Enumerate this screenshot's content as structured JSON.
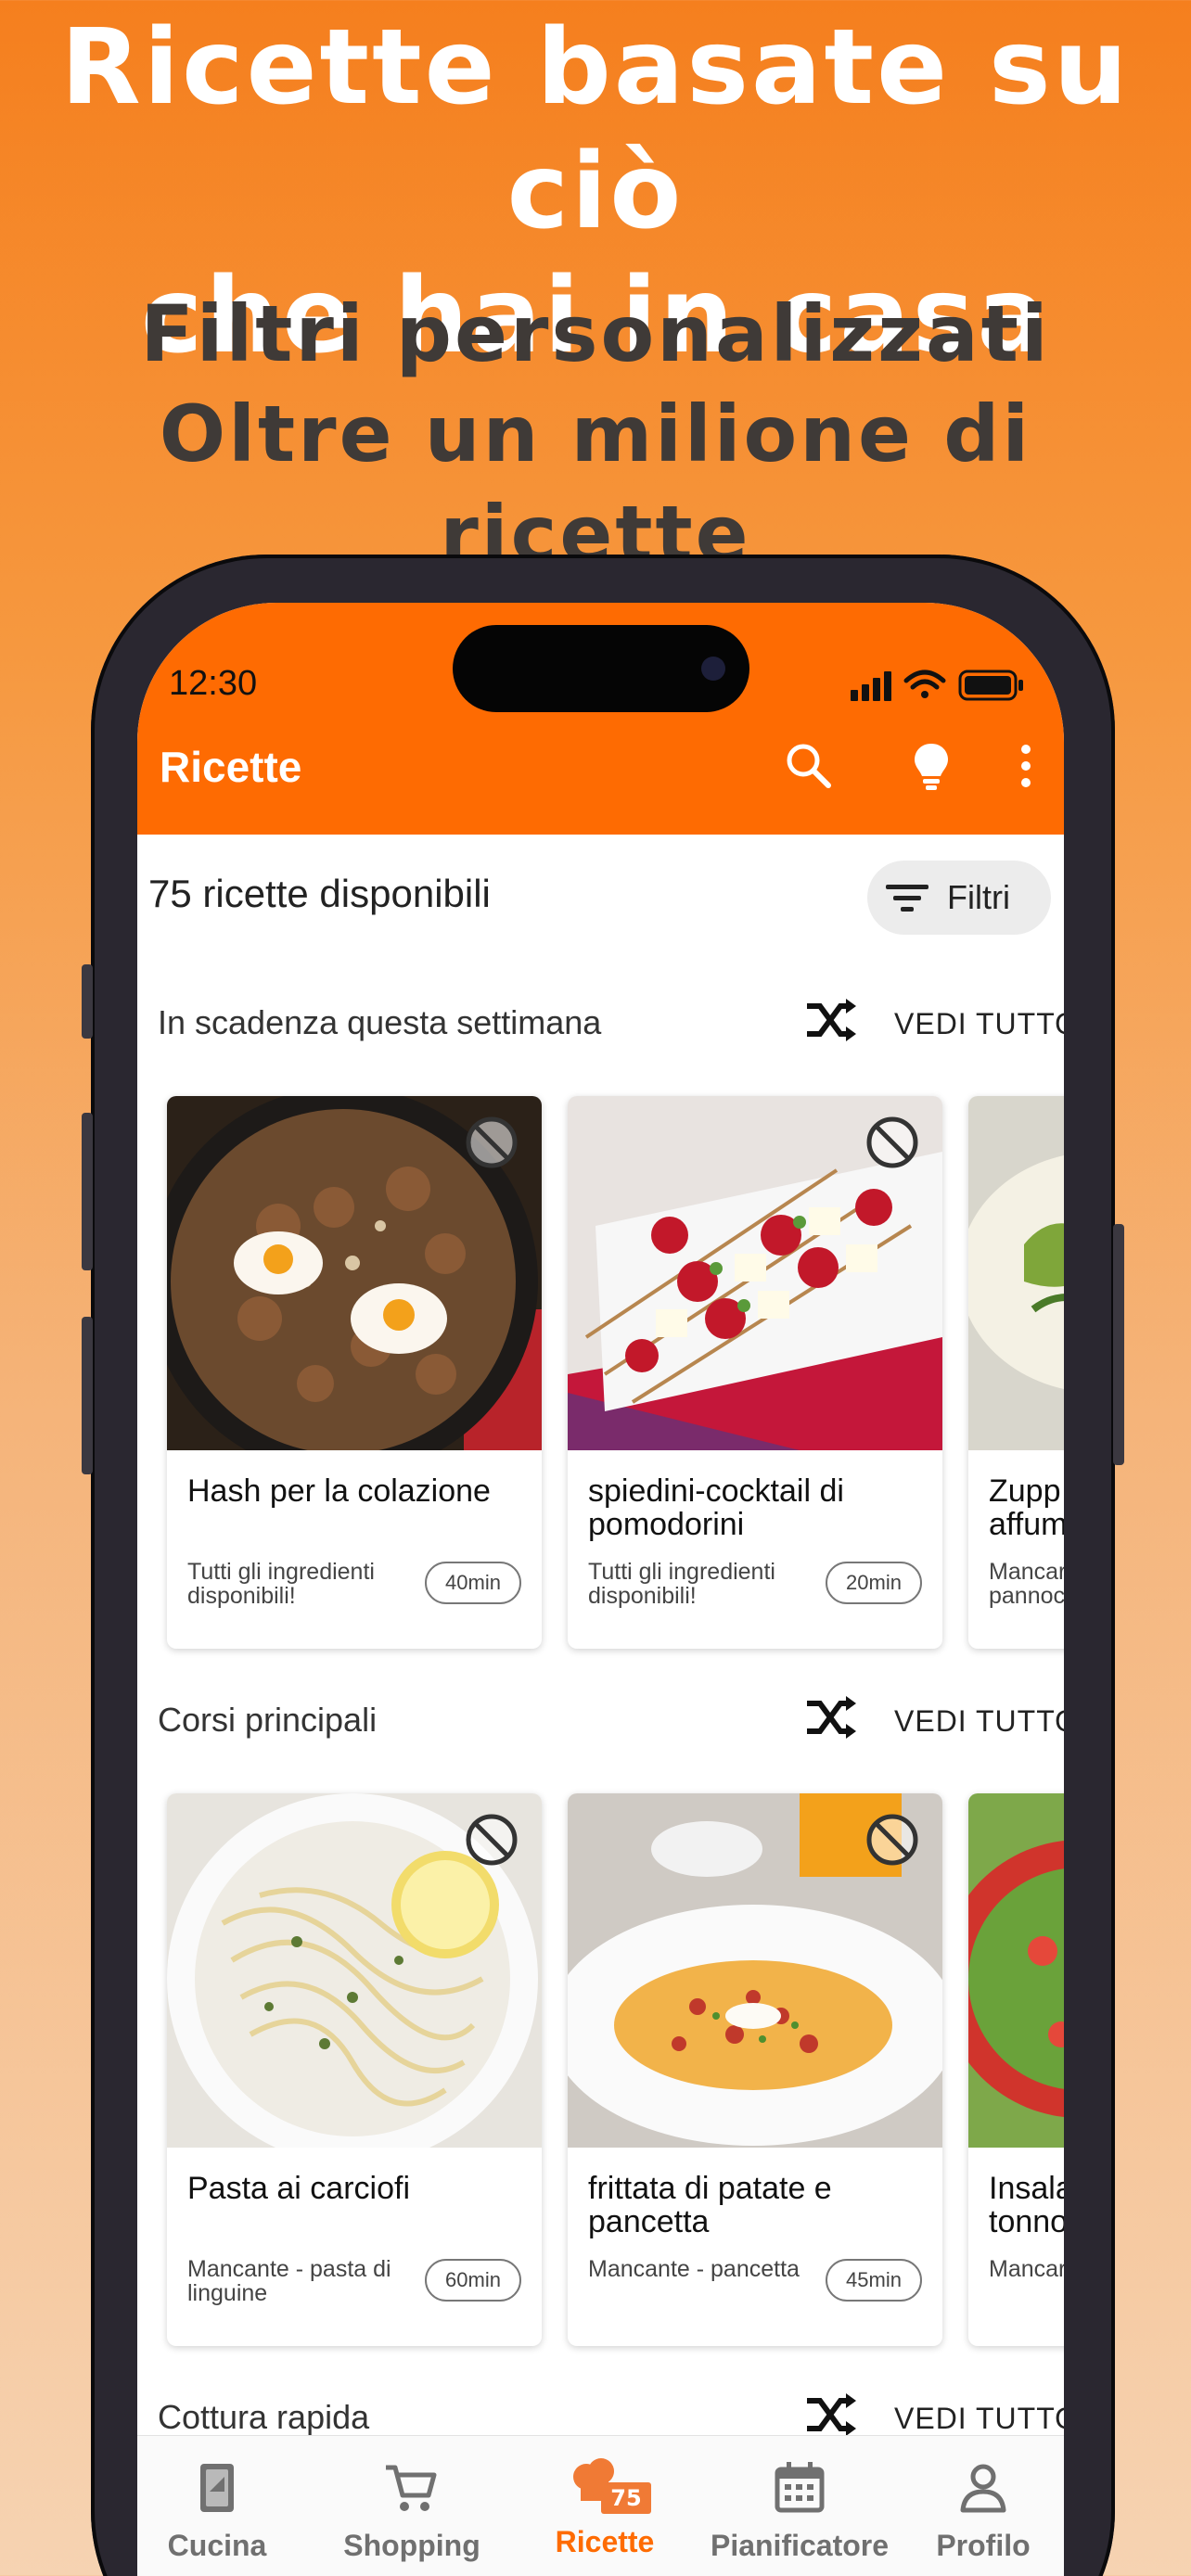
{
  "promo": {
    "headline_line1": "Ricette basate su ciò",
    "headline_line2": "che hai in casa",
    "sub_line1": "Filtri personalizzati",
    "sub_line2": "Oltre un milione di ricette"
  },
  "status_bar": {
    "time": "12:30"
  },
  "app_bar": {
    "title": "Ricette",
    "icons": [
      "search-icon",
      "lightbulb-icon",
      "more-vert-icon"
    ]
  },
  "summary": {
    "count_text": "75 ricette disponibili",
    "filter_label": "Filtri"
  },
  "colors": {
    "accent": "#fe6b02",
    "headline": "#ffffff",
    "sub": "#3f3a37"
  },
  "sections": [
    {
      "title": "In scadenza questa settimana",
      "see_all": "VEDI TUTTO",
      "cards": [
        {
          "name": "Hash per la colazione",
          "availability": "Tutti gli ingredienti disponibili!",
          "time": "40min"
        },
        {
          "name": "spiedini-cocktail di pomodorini",
          "availability": "Tutti gli ingredienti disponibili!",
          "time": "20min"
        },
        {
          "name": "Zupp affum",
          "availability": "Mancar pannoc",
          "time": ""
        }
      ]
    },
    {
      "title": "Corsi principali",
      "see_all": "VEDI TUTTO",
      "cards": [
        {
          "name": "Pasta ai carciofi",
          "availability": "Mancante - pasta di linguine",
          "time": "60min"
        },
        {
          "name": "frittata di patate e pancetta",
          "availability": "Mancante - pancetta",
          "time": "45min"
        },
        {
          "name": "Insala tonno",
          "availability": "Mancar",
          "time": ""
        }
      ]
    },
    {
      "title": "Cottura rapida",
      "see_all": "VEDI TUTTO"
    }
  ],
  "tabs": [
    {
      "label": "Cucina",
      "icon": "kitchen-icon"
    },
    {
      "label": "Shopping",
      "icon": "cart-icon"
    },
    {
      "label": "Ricette",
      "icon": "chef-hat-icon",
      "badge": "75"
    },
    {
      "label": "Pianificatore",
      "icon": "calendar-icon"
    },
    {
      "label": "Profilo",
      "icon": "person-icon"
    }
  ]
}
